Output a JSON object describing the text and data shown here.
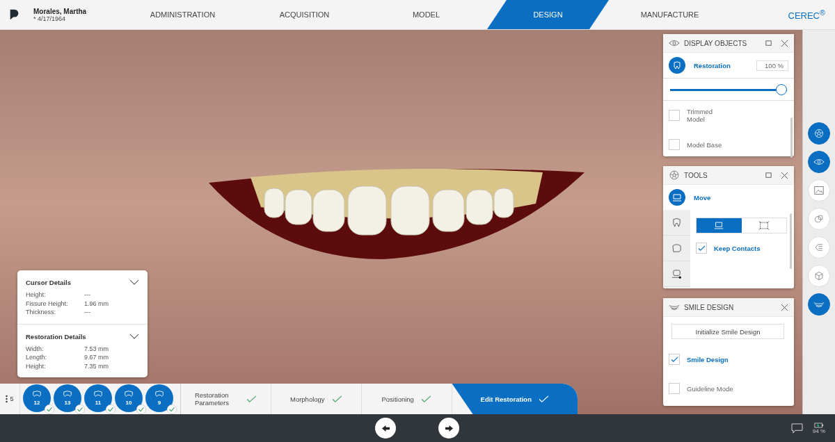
{
  "header": {
    "patient_name": "Morales, Martha",
    "birth_date": "* 4/17/1964",
    "brand": "CEREC$^{®}$"
  },
  "nav_tabs": [
    {
      "label": "ADMINISTRATION",
      "selected": false
    },
    {
      "label": "ACQUISITION",
      "selected": false
    },
    {
      "label": "MODEL",
      "selected": false
    },
    {
      "label": "DESIGN",
      "selected": true
    },
    {
      "label": "MANUFACTURE",
      "selected": false
    }
  ],
  "display_objects": {
    "title": "DISPLAY OBJECTS",
    "restoration_label": "Restoration",
    "opacity_value": "100 %",
    "level": 1,
    "items": [
      {
        "label": "Trimmed Model",
        "checked": false
      },
      {
        "label": "Model Base",
        "checked": false
      }
    ]
  },
  "tools": {
    "title": "TOOLS",
    "active_tool": "Move",
    "side_tabs": [
      {
        "kind": "tooth"
      },
      {
        "kind": "crown"
      },
      {
        "kind": "margin"
      }
    ],
    "modes": [
      {
        "kind": "move",
        "selected": true
      },
      {
        "kind": "scale",
        "selected": false
      }
    ],
    "options": [
      {
        "label": "Keep Contacts",
        "checked": true
      }
    ]
  },
  "smile_design": {
    "title": "SMILE DESIGN",
    "button": "Initialize Smile Design",
    "options": [
      {
        "label": "Smile Design",
        "checked": true
      },
      {
        "label": "Guideline Mode",
        "checked": false
      }
    ]
  },
  "rail": [
    {
      "kind": "tools",
      "selected": true
    },
    {
      "kind": "eye",
      "selected": true
    },
    {
      "kind": "image",
      "selected": false
    },
    {
      "kind": "layers",
      "selected": false
    },
    {
      "kind": "align",
      "selected": false
    },
    {
      "kind": "cube",
      "selected": false
    },
    {
      "kind": "smile",
      "selected": true
    }
  ],
  "cursor_details": {
    "title": "Cursor Details",
    "rows": [
      {
        "label": "Height:",
        "value": "---"
      },
      {
        "label": "Fissure Height:",
        "value": "1.96 mm"
      },
      {
        "label": "Thickness:",
        "value": "---"
      }
    ]
  },
  "restoration_details": {
    "title": "Restoration Details",
    "rows": [
      {
        "label": "Width:",
        "value": "7.53 mm"
      },
      {
        "label": "Length:",
        "value": "9.67 mm"
      },
      {
        "label": "Height:",
        "value": "7.35 mm"
      }
    ]
  },
  "teeth_count": "5",
  "teeth": [
    {
      "number": "12",
      "done": true
    },
    {
      "number": "13",
      "done": true
    },
    {
      "number": "11",
      "done": true
    },
    {
      "number": "10",
      "done": true
    },
    {
      "number": "9",
      "done": true
    }
  ],
  "steps": [
    {
      "label": "Restoration Parameters",
      "done": true,
      "selected": false
    },
    {
      "label": "Morphology",
      "done": true,
      "selected": false
    },
    {
      "label": "Positioning",
      "done": true,
      "selected": false
    },
    {
      "label": "Edit Restoration",
      "done": true,
      "selected": true
    }
  ],
  "footer": {
    "battery": "94 %"
  }
}
